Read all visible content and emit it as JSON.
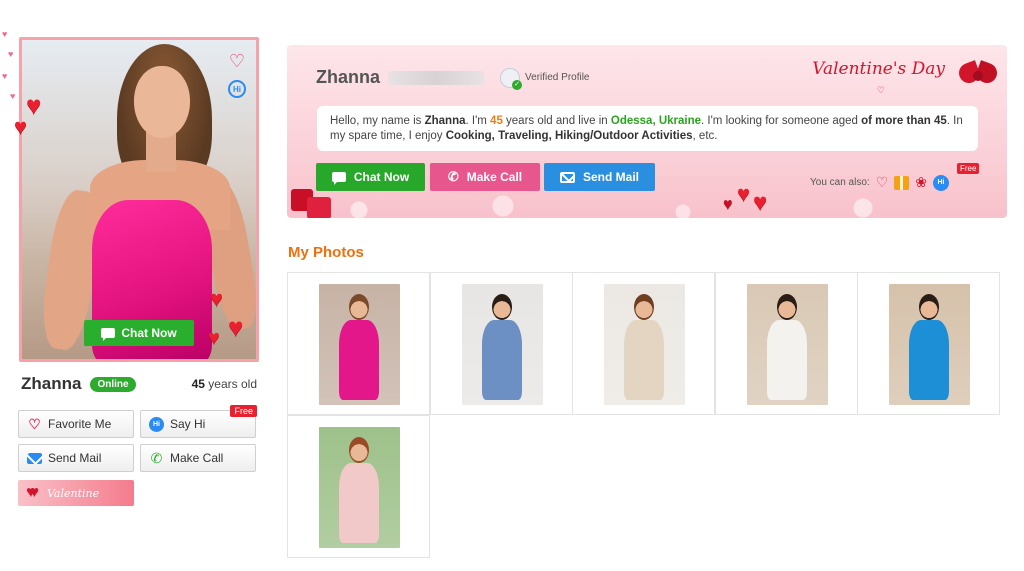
{
  "profile": {
    "name": "Zhanna",
    "status": "Online",
    "age_number": "45",
    "age_suffix": " years old",
    "photo_chat_label": "Chat Now"
  },
  "actions": {
    "favorite": "Favorite Me",
    "say_hi": "Say Hi",
    "say_hi_tag": "Free",
    "send_mail": "Send Mail",
    "make_call": "Make Call",
    "valentine_label": "Valentine"
  },
  "banner": {
    "name": "Zhanna",
    "verified": "Verified Profile",
    "valentines_title": "Valentine's Day",
    "intro": {
      "p1": "Hello, my name is ",
      "name": "Zhanna",
      "p2": ". I'm ",
      "age": "45",
      "p3": " years old and live in ",
      "location": "Odessa, Ukraine",
      "p4": ". I'm looking for someone aged ",
      "seek": "of more than 45",
      "p5": ". In my spare time, I enjoy ",
      "hobbies": "Cooking, Traveling, Hiking/Outdoor Activities",
      "p6": ", etc."
    },
    "buttons": {
      "chat": "Chat Now",
      "call": "Make Call",
      "mail": "Send Mail"
    },
    "can_also": "You can also:",
    "free_tag": "Free"
  },
  "photos": {
    "title": "My Photos",
    "items": [
      {
        "bg": "#c7b3a6",
        "body": "#e3168a",
        "hair": "#7a4a2a"
      },
      {
        "bg": "#e8e6e4",
        "body": "#6c8fc4",
        "hair": "#2a1d16"
      },
      {
        "bg": "#ece8e3",
        "body": "#e4d5c2",
        "hair": "#6e3e22"
      },
      {
        "bg": "#d9c8b5",
        "body": "#f4f2ef",
        "hair": "#2a1d16"
      },
      {
        "bg": "#d6c2ab",
        "body": "#1d8fd6",
        "hair": "#2a1d16"
      },
      {
        "bg": "#9ec18a",
        "body": "#f1c9c9",
        "hair": "#9a4a26"
      }
    ]
  },
  "colors": {
    "accent_orange": "#f06f0c",
    "chat_green": "#27a82b",
    "call_pink": "#e8568e",
    "mail_blue": "#2a8fe0",
    "online_green": "#2dab2d",
    "valentine_red": "#d3152b"
  }
}
